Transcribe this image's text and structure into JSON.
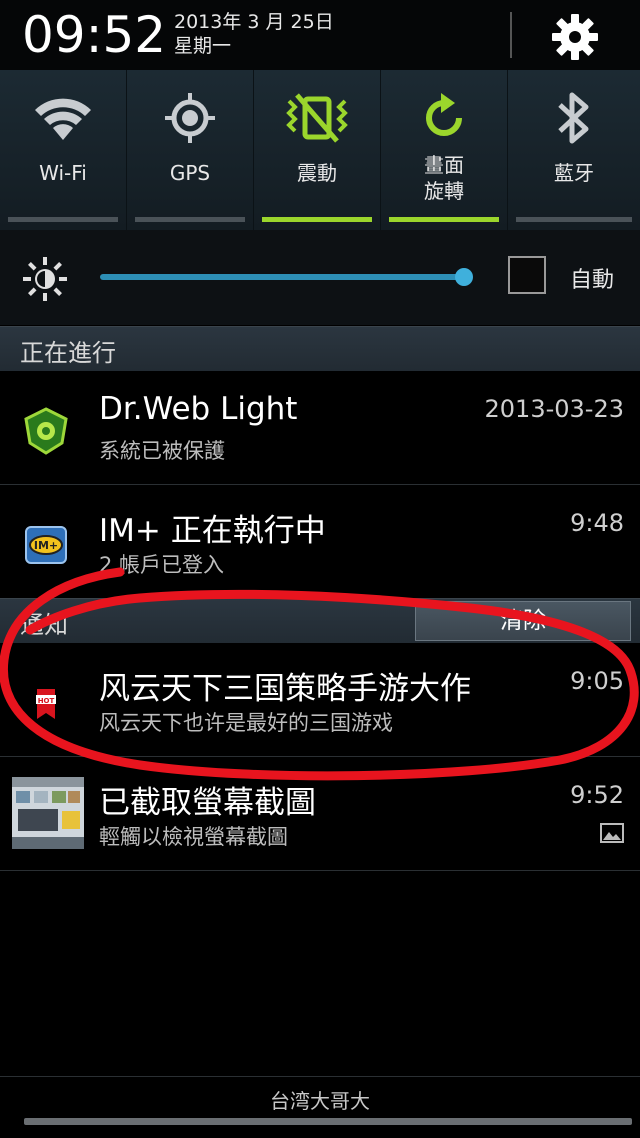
{
  "status": {
    "time": "09:52",
    "date": "2013年 3 月 25日",
    "weekday": "星期一"
  },
  "quick_settings": [
    {
      "label": "Wi-Fi",
      "icon": "wifi-icon",
      "active": false
    },
    {
      "label": "GPS",
      "icon": "gps-icon",
      "active": false
    },
    {
      "label": "震動",
      "icon": "vibrate-icon",
      "active": true
    },
    {
      "label": "畫面\n旋轉",
      "label_line1": "畫面",
      "label_line2": "旋轉",
      "icon": "rotate-icon",
      "active": true
    },
    {
      "label": "藍牙",
      "icon": "bluetooth-icon",
      "active": false
    }
  ],
  "brightness": {
    "level": 0.97,
    "auto_label": "自動",
    "auto_checked": false
  },
  "ongoing": {
    "header": "正在進行",
    "items": [
      {
        "title": "Dr.Web Light",
        "subtitle": "系統已被保護",
        "time": "2013-03-23",
        "icon": "drweb-shield-icon"
      },
      {
        "title": "IM+ 正在執行中",
        "subtitle": "2 帳戶已登入",
        "time": "9:48",
        "icon": "im-plus-icon"
      }
    ]
  },
  "notifications": {
    "header": "通知",
    "clear_label": "清除",
    "items": [
      {
        "title": "风云天下三国策略手游大作",
        "subtitle": "风云天下也许是最好的三国游戏",
        "time": "9:05",
        "icon": "hot-tag-icon"
      },
      {
        "title": "已截取螢幕截圖",
        "subtitle": "輕觸以檢視螢幕截圖",
        "time": "9:52",
        "icon": "screenshot-thumbnail-icon"
      }
    ]
  },
  "footer": {
    "carrier": "台湾大哥大"
  },
  "colors": {
    "accent_active": "#9bd62c",
    "slider": "#2d8fb6",
    "annotation": "#e8141e"
  }
}
